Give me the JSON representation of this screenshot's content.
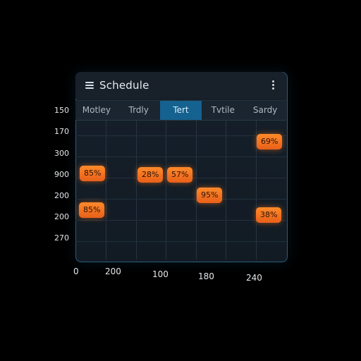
{
  "app": {
    "title": "Schedule"
  },
  "tabs": [
    {
      "label": "Motley",
      "active": false
    },
    {
      "label": "Trdly",
      "active": false
    },
    {
      "label": "Tert",
      "active": true
    },
    {
      "label": "Tvtile",
      "active": false
    },
    {
      "label": "Sardy",
      "active": false
    }
  ],
  "y_axis_labels": [
    "150",
    "170",
    "300",
    "900",
    "200",
    "200",
    "270"
  ],
  "x_axis_labels": [
    "0",
    "200",
    "100",
    "180",
    "240"
  ],
  "events": [
    {
      "label": "85%",
      "column": 0
    },
    {
      "label": "28%",
      "column": 2
    },
    {
      "label": "57%",
      "column": 3
    },
    {
      "label": "95%",
      "column": 4
    },
    {
      "label": "69%",
      "column": 6
    },
    {
      "label": "85%",
      "column": 0
    },
    {
      "label": "38%",
      "column": 6
    }
  ],
  "colors": {
    "accent": "#15618f",
    "chip": "#f07020",
    "background": "#000000",
    "panel": "#16202a"
  },
  "icons": {
    "menu": "hamburger-icon",
    "more": "kebab-icon"
  }
}
